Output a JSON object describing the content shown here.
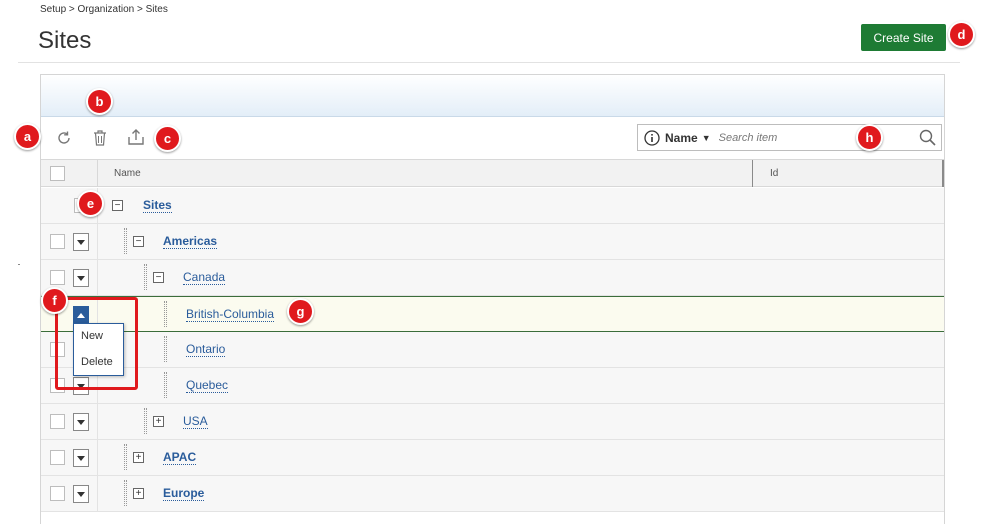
{
  "breadcrumb": "Setup > Organization > Sites",
  "page_title": "Sites",
  "create_button": "Create Site",
  "search": {
    "field_label": "Name",
    "placeholder": "Search item"
  },
  "columns": {
    "name": "Name",
    "id": "Id"
  },
  "tree": {
    "sites": "Sites",
    "americas": "Americas",
    "canada": "Canada",
    "british_columbia": "British-Columbia",
    "ontario": "Ontario",
    "quebec": "Quebec",
    "usa": "USA",
    "apac": "APAC",
    "europe": "Europe"
  },
  "menu": {
    "new": "New",
    "delete": "Delete"
  },
  "callouts": {
    "a": "a",
    "b": "b",
    "c": "c",
    "d": "d",
    "e": "e",
    "f": "f",
    "g": "g",
    "h": "h"
  },
  "icons": {
    "refresh": "refresh-icon",
    "delete": "trash-icon",
    "export": "export-icon",
    "info": "info-icon",
    "search": "search-icon"
  },
  "colors": {
    "primary": "#1e7b34",
    "link": "#2a5c9b",
    "callout": "#e0191d"
  }
}
